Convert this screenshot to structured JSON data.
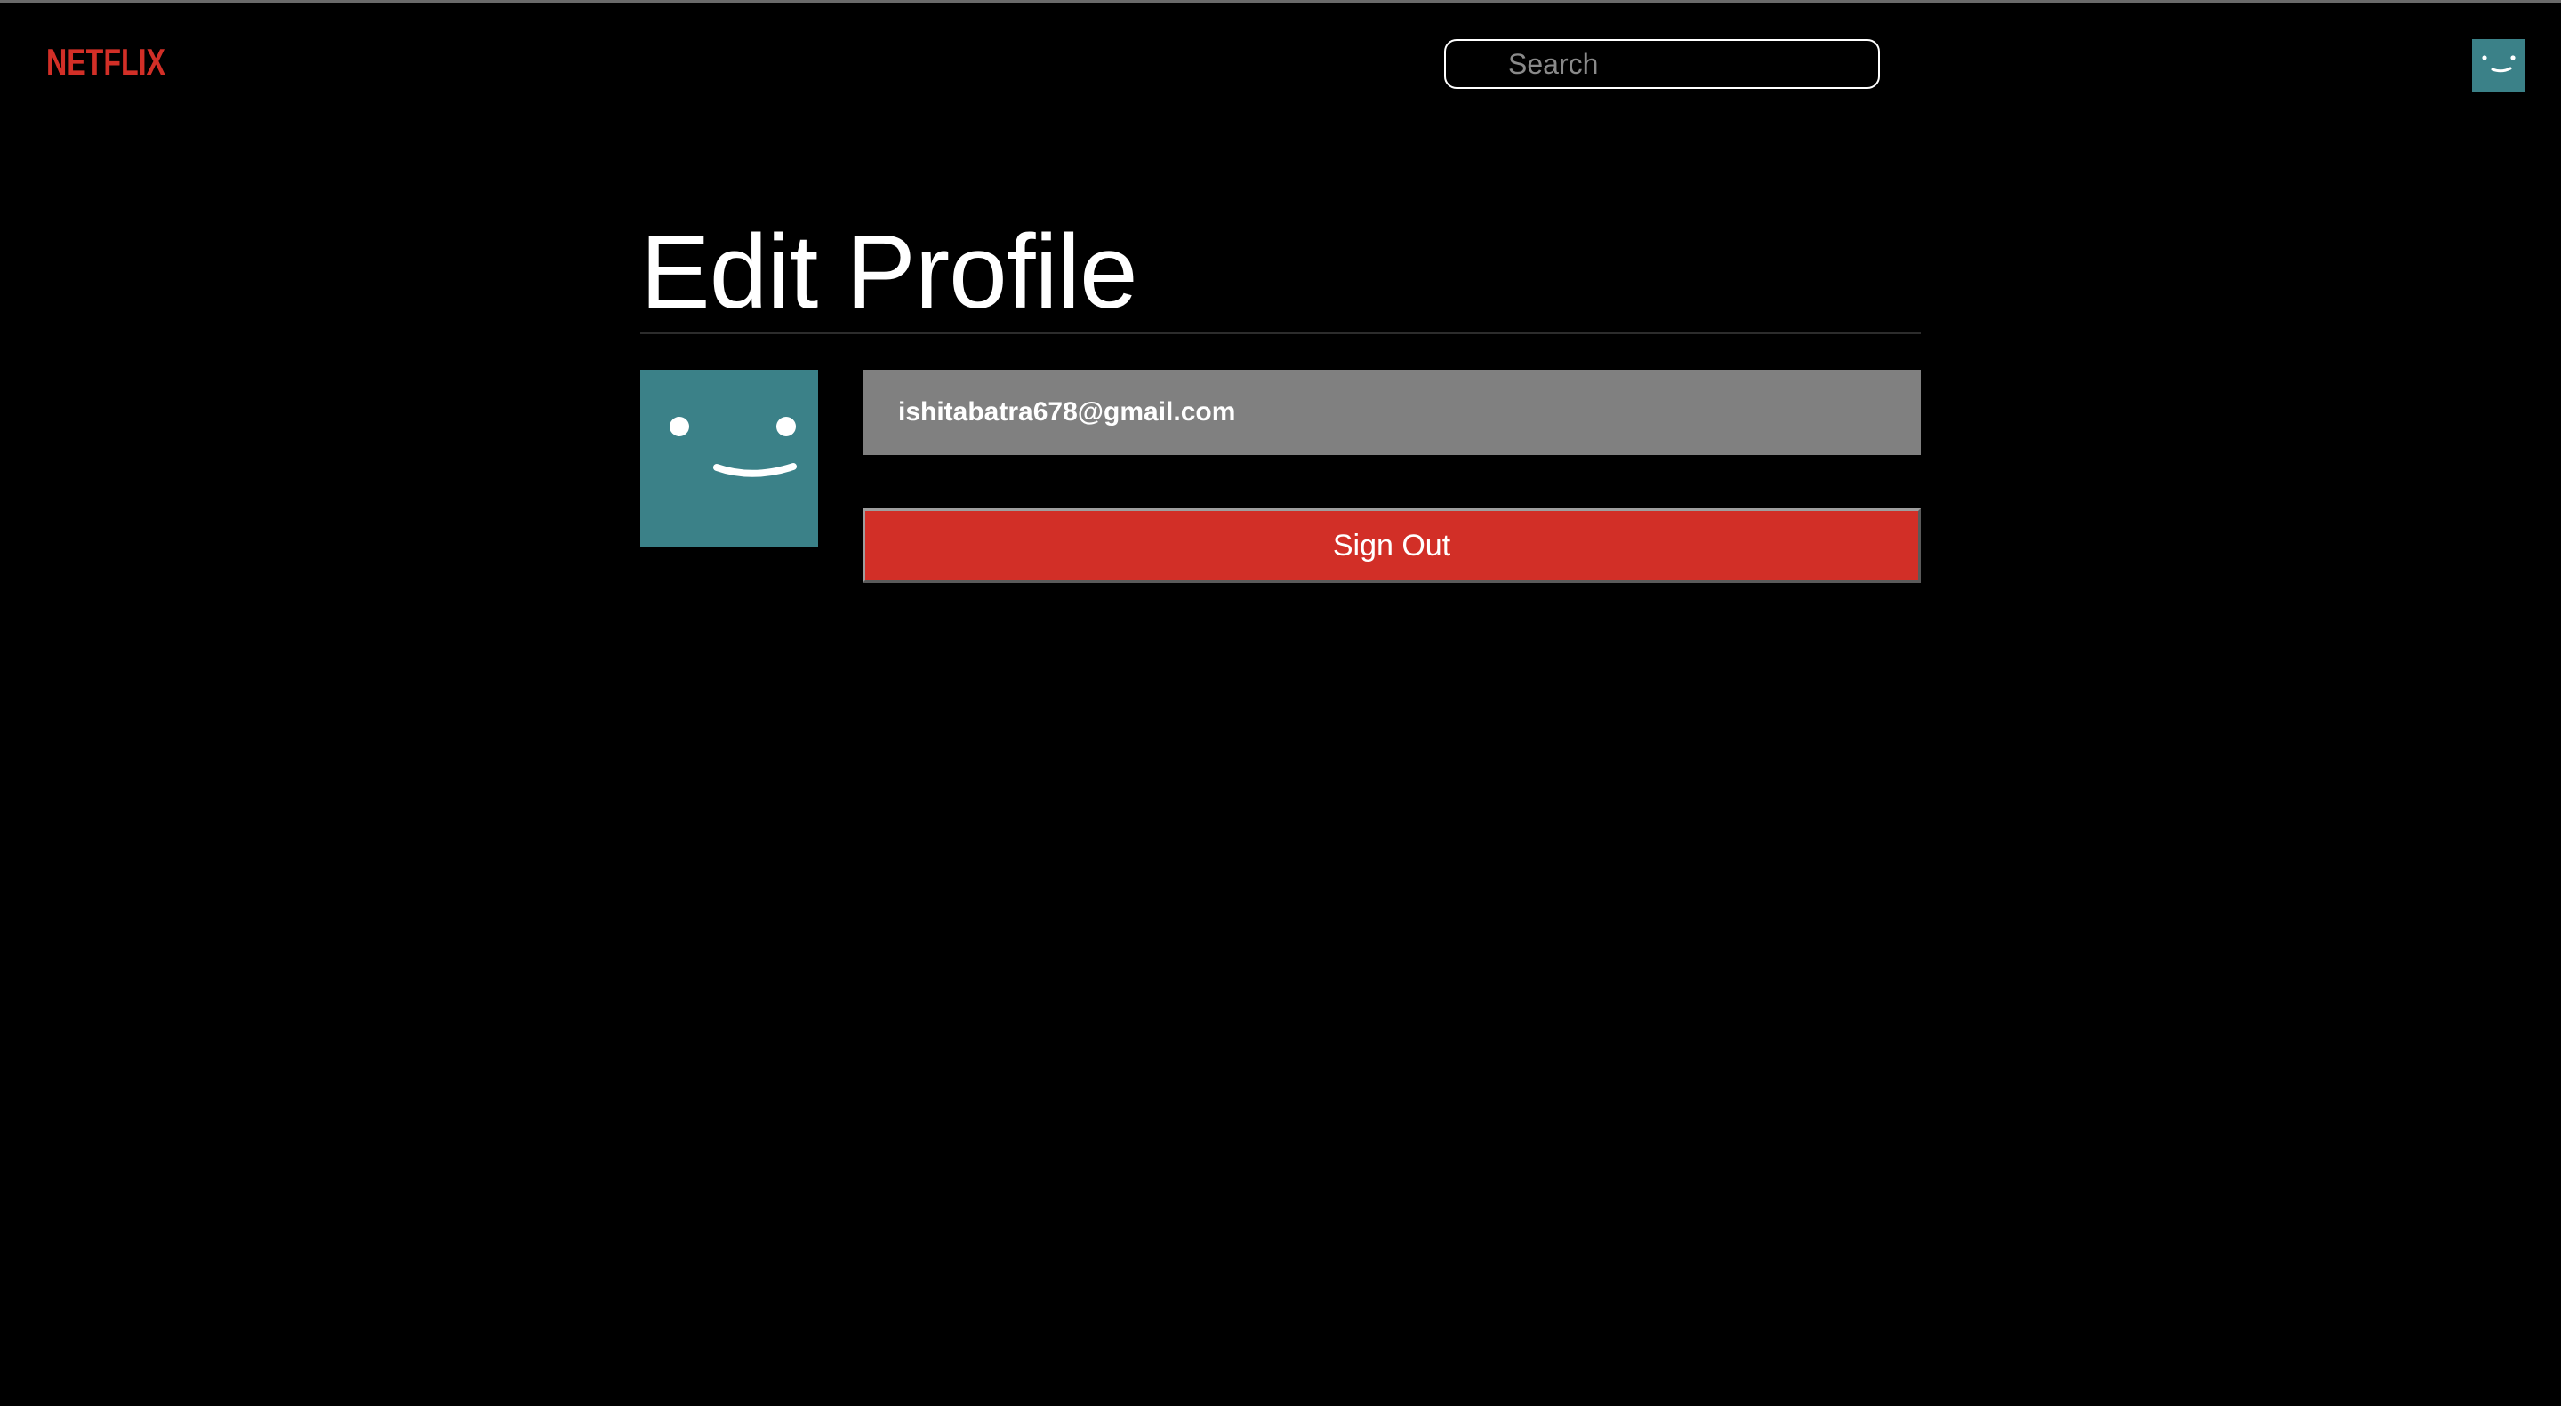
{
  "brand": {
    "logo_text": "NETFLIX",
    "color": "#d22f27"
  },
  "search": {
    "placeholder": "Search",
    "value": ""
  },
  "nav": {
    "avatar_icon": "smiley-face-icon",
    "avatar_color": "#3b8188"
  },
  "profile": {
    "title": "Edit Profile",
    "avatar_icon": "smiley-face-icon",
    "avatar_color": "#3b8188",
    "email": "ishitabatra678@gmail.com",
    "signout_label": "Sign Out",
    "signout_color": "#d22f27"
  }
}
